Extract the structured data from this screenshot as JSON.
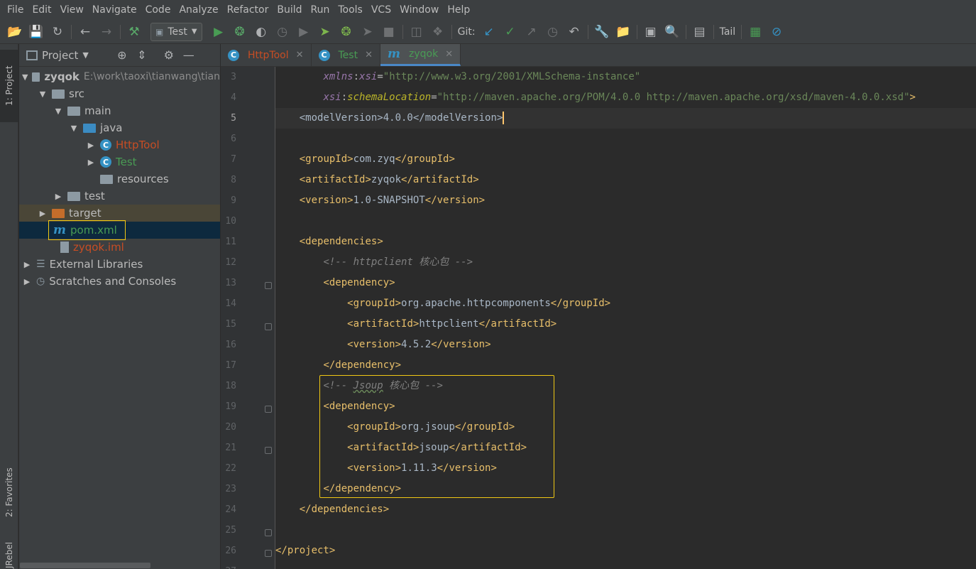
{
  "menu": [
    "File",
    "Edit",
    "View",
    "Navigate",
    "Code",
    "Analyze",
    "Refactor",
    "Build",
    "Run",
    "Tools",
    "VCS",
    "Window",
    "Help"
  ],
  "toolbar": {
    "run_config": "Test",
    "git_label": "Git:",
    "tail_label": "Tail",
    "icons": [
      "open-folder-icon",
      "save-icon",
      "sync-icon",
      "back-arrow-icon",
      "forward-arrow-icon",
      "build-hammer-icon",
      "run-icon",
      "debug-bug-icon",
      "coverage-icon",
      "profile-icon",
      "run-jrebel-icon",
      "debug-jrebel-icon",
      "stop-icon",
      "git-update-icon",
      "git-commit-icon",
      "git-history-icon",
      "rollback-icon",
      "settings-wrench-icon",
      "project-structure-icon",
      "search-icon",
      "tail-icon",
      "no-entry-icon"
    ]
  },
  "left_strip": {
    "project_tab": "1: Project",
    "favorites_tab": "2: Favorites",
    "jrebel_tab": "JRebel"
  },
  "project_panel": {
    "title": "Project",
    "tree": [
      {
        "label": "zyqok",
        "path": "E:\\work\\taoxi\\tianwang\\tian"
      },
      {
        "label": "src"
      },
      {
        "label": "main"
      },
      {
        "label": "java"
      },
      {
        "label": "HttpTool"
      },
      {
        "label": "Test"
      },
      {
        "label": "resources"
      },
      {
        "label": "test"
      },
      {
        "label": "target"
      },
      {
        "label": "pom.xml"
      },
      {
        "label": "zyqok.iml"
      },
      {
        "label": "External Libraries"
      },
      {
        "label": "Scratches and Consoles"
      }
    ]
  },
  "tabs": [
    {
      "label": "HttpTool"
    },
    {
      "label": "Test"
    },
    {
      "label": "zyqok"
    }
  ],
  "editor": {
    "lines": [
      {
        "num": "3",
        "text": "        xmlns:xsi=\"http://www.w3.org/2001/XMLSchema-instance\""
      },
      {
        "num": "4",
        "text": "        xsi:schemaLocation=\"http://maven.apache.org/POM/4.0.0 http://maven.apache.org/xsd/maven-4.0.0.xsd\">"
      },
      {
        "num": "5",
        "text": "    <modelVersion>4.0.0</modelVersion>"
      },
      {
        "num": "6",
        "text": ""
      },
      {
        "num": "7",
        "text": "    <groupId>com.zyq</groupId>"
      },
      {
        "num": "8",
        "text": "    <artifactId>zyqok</artifactId>"
      },
      {
        "num": "9",
        "text": "    <version>1.0-SNAPSHOT</version>"
      },
      {
        "num": "10",
        "text": ""
      },
      {
        "num": "11",
        "text": "    <dependencies>"
      },
      {
        "num": "12",
        "text": "        <!-- httpclient 核心包 -->"
      },
      {
        "num": "13",
        "text": "        <dependency>"
      },
      {
        "num": "14",
        "text": "            <groupId>org.apache.httpcomponents</groupId>"
      },
      {
        "num": "15",
        "text": "            <artifactId>httpclient</artifactId>"
      },
      {
        "num": "16",
        "text": "            <version>4.5.2</version>"
      },
      {
        "num": "17",
        "text": "        </dependency>"
      },
      {
        "num": "18",
        "text": "        <!-- Jsoup 核心包 -->"
      },
      {
        "num": "19",
        "text": "        <dependency>"
      },
      {
        "num": "20",
        "text": "            <groupId>org.jsoup</groupId>"
      },
      {
        "num": "21",
        "text": "            <artifactId>jsoup</artifactId>"
      },
      {
        "num": "22",
        "text": "            <version>1.11.3</version>"
      },
      {
        "num": "23",
        "text": "        </dependency>"
      },
      {
        "num": "24",
        "text": "    </dependencies>"
      },
      {
        "num": "25",
        "text": ""
      },
      {
        "num": "26",
        "text": "</project>"
      },
      {
        "num": "27",
        "text": ""
      }
    ]
  }
}
